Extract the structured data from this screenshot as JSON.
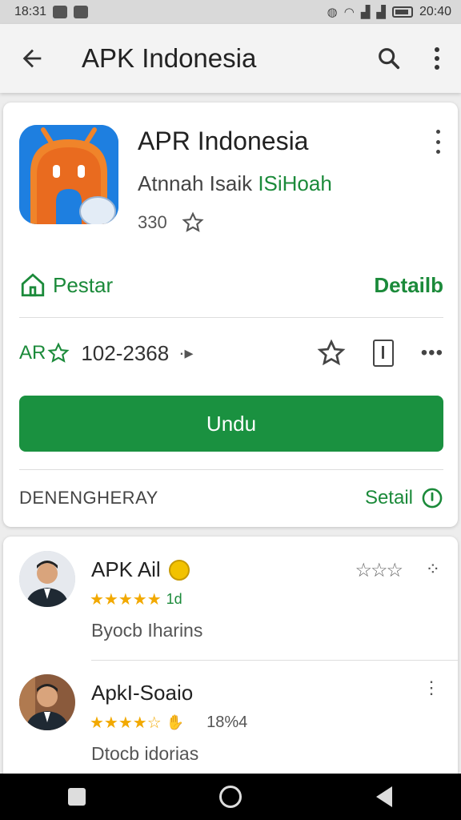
{
  "status_bar": {
    "time": "18:31",
    "clock_right": "20:40"
  },
  "app_bar": {
    "title": "APK Indonesia"
  },
  "app": {
    "name": "APR Indonesia",
    "developer_prefix": "Atnnah Isaik ",
    "developer_accent": "ISiHoah",
    "rating_value": "330",
    "install_row_label": "Pestar",
    "details_link": "Detailb",
    "stats_tag": "AR",
    "stats_count": "102-2368",
    "install_button": "Undu",
    "footer_label": "DENENGHERAY",
    "footer_link": "Setail"
  },
  "reviews": [
    {
      "name": "APK Ail",
      "stars_extra": "1d",
      "count": "",
      "text": "Byocb Iharins"
    },
    {
      "name": "ApkI-Soaio",
      "stars_extra": "",
      "count": "18%4",
      "text": "Dtocb idorias"
    }
  ],
  "icons": {
    "back": "arrow-left-icon",
    "search": "search-icon",
    "more": "more-vert-icon",
    "star": "star-icon",
    "home": "home-icon",
    "info": "info-icon"
  },
  "colors": {
    "accent_green": "#1a9140",
    "link_green": "#1b8a3a",
    "star_gold": "#f2a900"
  }
}
